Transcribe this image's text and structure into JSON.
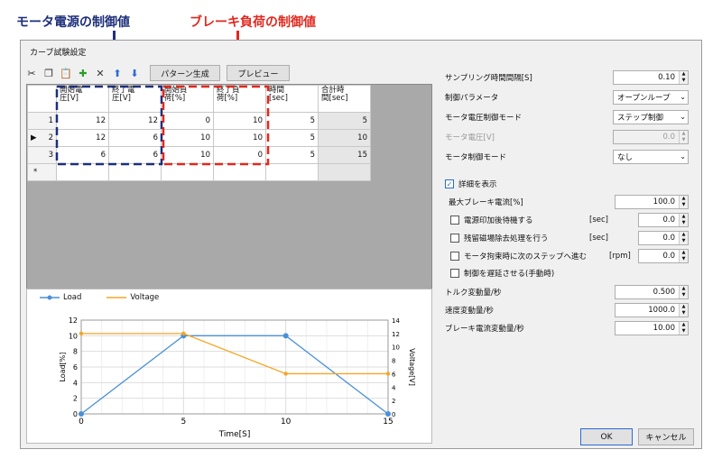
{
  "annotations": {
    "motor_label": "モータ電源の制御値",
    "brake_label": "ブレーキ負荷の制御値",
    "motor_color": "#1e2f7a",
    "brake_color": "#e0281e"
  },
  "window": {
    "title": "カーブ試験設定"
  },
  "toolbar": {
    "pattern_button": "パターン生成",
    "preview_button": "プレビュー"
  },
  "table": {
    "headers": [
      "開始電\n圧[V]",
      "終了電\n圧[V]",
      "開始負\n荷[%]",
      "終了負\n荷[%]",
      "時間\n[sec]",
      "合計時\n間[sec]"
    ],
    "rows": [
      {
        "no": "1",
        "marker": "",
        "cells": [
          "12",
          "12",
          "0",
          "10",
          "5",
          "5"
        ]
      },
      {
        "no": "2",
        "marker": "▶",
        "cells": [
          "12",
          "6",
          "10",
          "10",
          "5",
          "10"
        ]
      },
      {
        "no": "3",
        "marker": "",
        "cells": [
          "6",
          "6",
          "10",
          "0",
          "5",
          "15"
        ]
      }
    ],
    "new_row_marker": "*"
  },
  "chart_data": {
    "type": "line",
    "x": [
      0,
      5,
      10,
      15
    ],
    "series": [
      {
        "name": "Load",
        "axis": "left",
        "values": [
          0,
          10,
          10,
          0
        ],
        "color": "#4a90d9"
      },
      {
        "name": "Voltage",
        "axis": "right",
        "values": [
          12,
          12,
          6,
          6
        ],
        "color": "#f5a623"
      }
    ],
    "xlabel": "Time[S]",
    "ylabel": "Load[%]",
    "y2label": "Voltage[V]",
    "xlim": [
      0,
      15
    ],
    "ylim": [
      0,
      12
    ],
    "y2lim": [
      0,
      14
    ],
    "xticks": [
      "0",
      "5",
      "10",
      "15"
    ],
    "yticks": [
      "0",
      "2",
      "4",
      "6",
      "8",
      "10",
      "12"
    ],
    "y2ticks": [
      "0",
      "2",
      "4",
      "6",
      "8",
      "10",
      "12",
      "14"
    ],
    "grid": true,
    "legend_position": "top-left"
  },
  "settings": {
    "sampling_label": "サンプリング時間間隔[S]",
    "sampling_value": "0.10",
    "control_param_label": "制御パラメータ",
    "control_param_value": "オープンループ",
    "voltage_mode_label": "モータ電圧制御モード",
    "voltage_mode_value": "ステップ制御",
    "motor_voltage_label": "モータ電圧[V]",
    "motor_voltage_value": "0.0",
    "motor_control_label": "モータ制御モード",
    "motor_control_value": "なし",
    "details_label": "詳細を表示",
    "max_brake_label": "最大ブレーキ電流[%]",
    "max_brake_value": "100.0",
    "wait_label": "電源印加後待機する",
    "wait_unit": "[sec]",
    "wait_value": "0.0",
    "demag_label": "残留磁場除去処理を行う",
    "demag_unit": "[sec]",
    "demag_value": "0.0",
    "lock_label": "モータ拘束時に次のステップへ進む",
    "lock_unit": "[rpm]",
    "lock_value": "0.0",
    "delay_label": "制御を遅延させる(手動時)",
    "torque_label": "トルク変動量/秒",
    "torque_value": "0.500",
    "speed_label": "速度変動量/秒",
    "speed_value": "1000.0",
    "brake_rate_label": "ブレーキ電流変動量/秒",
    "brake_rate_value": "10.00",
    "ok": "OK",
    "cancel": "キャンセル"
  }
}
